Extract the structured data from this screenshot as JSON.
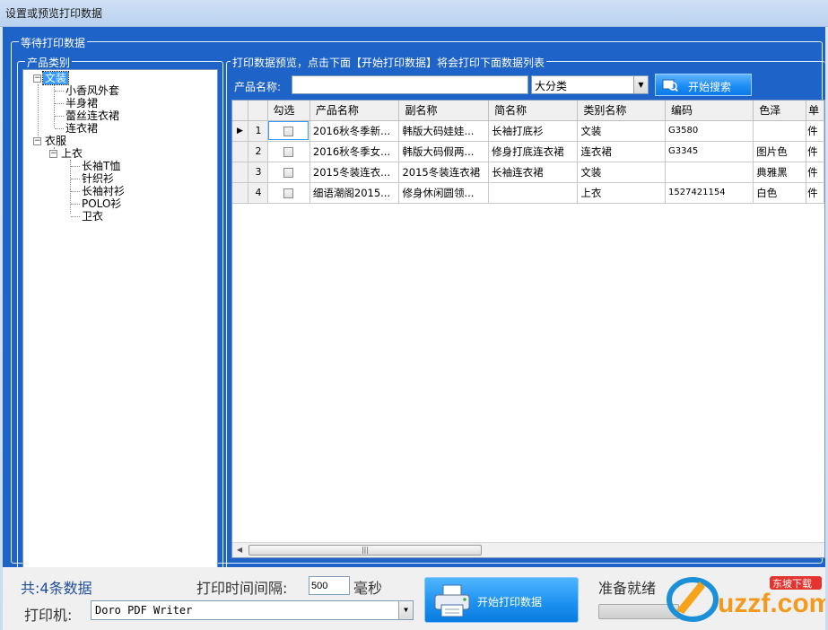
{
  "window": {
    "title": "设置或预览打印数据"
  },
  "groups": {
    "waiting": "等待打印数据",
    "category": "产品类别",
    "preview": "打印数据预览，点击下面【开始打印数据】将会打印下面数据列表"
  },
  "tree": {
    "nodes": [
      {
        "label": "文装"
      },
      {
        "label": "小香风外套"
      },
      {
        "label": "半身裙"
      },
      {
        "label": "蕾丝连衣裙"
      },
      {
        "label": "连衣裙"
      },
      {
        "label": "衣服"
      },
      {
        "label": "上衣"
      },
      {
        "label": "长袖T恤"
      },
      {
        "label": "针织衫"
      },
      {
        "label": "长袖衬衫"
      },
      {
        "label": "POLO衫"
      },
      {
        "label": "卫衣"
      }
    ]
  },
  "search": {
    "label": "产品名称:",
    "value": "",
    "category_selected": "大分类",
    "button": "开始搜索"
  },
  "grid": {
    "columns": [
      "勾选",
      "产品名称",
      "副名称",
      "简名称",
      "类别名称",
      "编码",
      "色泽",
      "单"
    ],
    "rows": [
      {
        "num": "1",
        "name": "2016秋冬季新...",
        "subname": "韩版大码娃娃...",
        "short": "长袖打底衫",
        "category": "文装",
        "code": "G3580",
        "color": "",
        "unit": "件"
      },
      {
        "num": "2",
        "name": "2016秋冬季女...",
        "subname": "韩版大码假两...",
        "short": "修身打底连衣裙",
        "category": "连衣裙",
        "code": "G3345",
        "color": "图片色",
        "unit": "件"
      },
      {
        "num": "3",
        "name": "2015冬装连衣...",
        "subname": "2015冬装连衣裙",
        "short": "长袖连衣裙",
        "category": "文装",
        "code": "",
        "color": "典雅黑",
        "unit": "件"
      },
      {
        "num": "4",
        "name": "细语潮阁2015...",
        "subname": "修身休闲圆领...",
        "short": "",
        "category": "上衣",
        "code": "1527421154",
        "color": "白色",
        "unit": "件"
      }
    ]
  },
  "footer": {
    "total": "共:4条数据",
    "interval_label": "打印时间间隔:",
    "interval_value": "500",
    "interval_unit": "毫秒",
    "printer_label": "打印机:",
    "printer_value": "Doro PDF Writer",
    "print_button": "开始打印数据",
    "status": "准备就绪"
  },
  "watermark": {
    "brand": "uzzf.com",
    "sub": "东坡下载"
  }
}
